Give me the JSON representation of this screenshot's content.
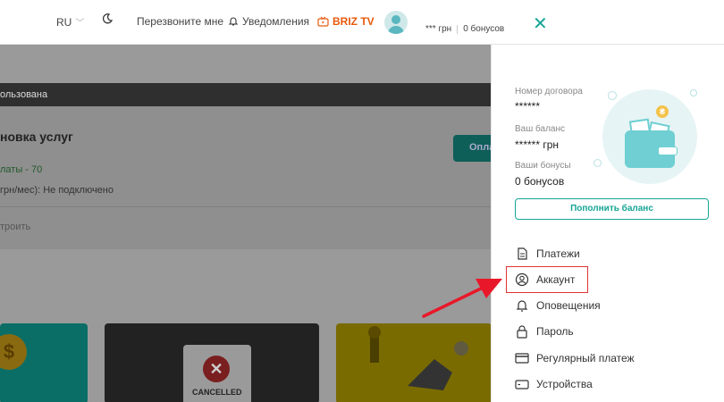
{
  "header": {
    "lang": "RU",
    "callback": "Перезвоните мне",
    "notifications": "Уведомления",
    "briz_tv": "BRIZ TV",
    "balance": "*** грн",
    "bonuses": "0 бонусов"
  },
  "background": {
    "band_text": "ользована",
    "card_title": "новка услуг",
    "card_green": "латы - 70",
    "card_text": "грн/мес): Не подключено",
    "card_text2": "троить",
    "button": "Опла",
    "cancelled": "CANCELLED"
  },
  "panel": {
    "contract_label": "Номер договора",
    "contract_value": "******",
    "balance_label": "Ваш баланс",
    "balance_value": "****** грн",
    "bonus_label": "Ваши бонусы",
    "bonus_value": "0 бонусов",
    "topup": "Пополнить баланс",
    "menu": [
      {
        "label": "Платежи",
        "icon": "document-icon"
      },
      {
        "label": "Аккаунт",
        "icon": "user-circle-icon"
      },
      {
        "label": "Оповещения",
        "icon": "bell-icon"
      },
      {
        "label": "Пароль",
        "icon": "lock-icon"
      },
      {
        "label": "Регулярный платеж",
        "icon": "card-icon"
      },
      {
        "label": "Устройства",
        "icon": "device-icon"
      }
    ]
  },
  "colors": {
    "accent": "#16a596",
    "highlight": "#dd3333",
    "arrow": "#e8182a"
  }
}
